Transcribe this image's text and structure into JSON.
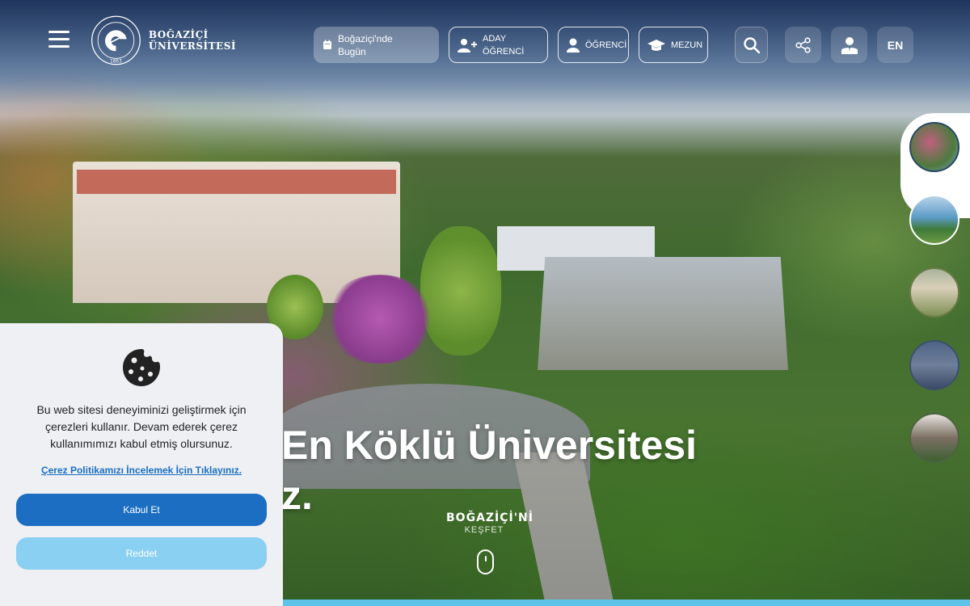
{
  "header": {
    "logo_text_line1": "BOĞAZİÇİ",
    "logo_text_line2": "ÜNİVERSİTESİ",
    "logo_seal_year": "1863",
    "logo_seal_ring": "BOĞAZİÇİ ÜNİVERSİTESİ",
    "nav": {
      "today_label_line1": "Boğaziçi'nde",
      "today_label_line2": "Bugün",
      "aday_label_line1": "ADAY",
      "aday_label_line2": "ÖĞRENCİ",
      "ogrenci_label": "ÖĞRENCİ",
      "mezun_label": "MEZUN"
    },
    "lang_label": "EN",
    "icons": {
      "menu": "hamburger-icon",
      "today": "calendar-icon",
      "aday": "user-plus-icon",
      "ogrenci": "student-icon",
      "mezun": "graduation-cap-icon",
      "search": "search-icon",
      "share": "share-icon",
      "user": "user-icon"
    }
  },
  "hero": {
    "headline_line1": "En Köklü Üniversitesi",
    "headline_line2": "z.",
    "discover_line1": "BOĞAZİÇİ'Nİ",
    "discover_line2": "KEŞFET"
  },
  "thumbnails": [
    "campus-thumb-1",
    "campus-thumb-2",
    "campus-thumb-3",
    "campus-thumb-4",
    "campus-thumb-5"
  ],
  "cookie": {
    "text": "Bu web sitesi deneyiminizi geliştirmek için çerezleri kullanır. Devam ederek çerez kullanımımızı kabul etmiş olursunuz.",
    "link_text": "Çerez Politikamızı İncelemek İçin Tıklayınız.",
    "accept_label": "Kabul Et",
    "reject_label": "Reddet"
  },
  "colors": {
    "accent_blue": "#1b6ec2",
    "reject_blue": "#8ad0f2",
    "bottom_strip": "#5ec3e8"
  }
}
